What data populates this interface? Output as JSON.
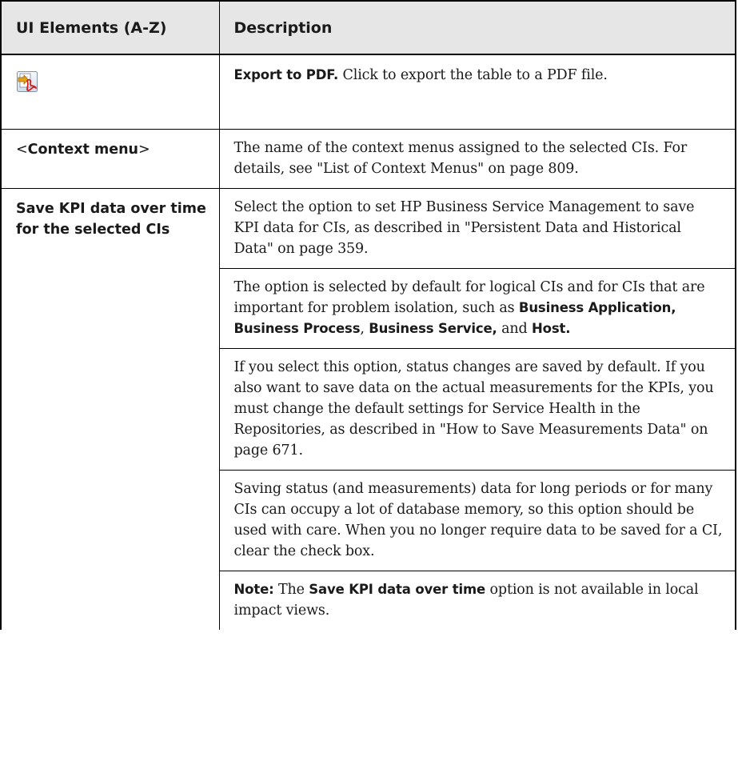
{
  "headers": {
    "col1": "UI Elements (A-Z)",
    "col2": "Description"
  },
  "icons": {
    "export_pdf": "export-to-pdf-icon"
  },
  "rows": {
    "export": {
      "lead": "Export to PDF.",
      "text": " Click to export the table to a PDF file."
    },
    "context_menu": {
      "lt": "<",
      "name": "Context menu",
      "gt": ">",
      "desc": "The name of the context menus assigned to the selected CIs. For details, see \"List of Context Menus\" on page 809."
    },
    "save_kpi": {
      "name": "Save KPI data over time for the selected CIs",
      "p1": "Select the option to set HP Business Service Management to save KPI data for CIs, as described in \"Persistent Data and Historical Data\" on page 359.",
      "p2_a": "The option is selected by default for logical CIs and for CIs that are important for problem isolation, such as ",
      "p2_b1": "Business Application, Business Process",
      "p2_c1": ", ",
      "p2_b2": "Business Service,",
      "p2_c2": " and ",
      "p2_b3": "Host.",
      "p3": "If you select this option, status changes are saved by default. If you also want to save data on the actual measurements for the KPIs, you must change the default settings for Service Health in the Repositories, as described in \"How to Save Measurements Data\" on page 671.",
      "p4": "Saving status (and measurements) data for long periods or for many CIs can occupy a lot of database memory, so this option should be used with care. When you no longer require data to be saved for a CI, clear the check box.",
      "note_label": "Note:",
      "note_a": " The ",
      "note_bold": "Save KPI data over time",
      "note_b": " option is not available in local impact views."
    }
  }
}
